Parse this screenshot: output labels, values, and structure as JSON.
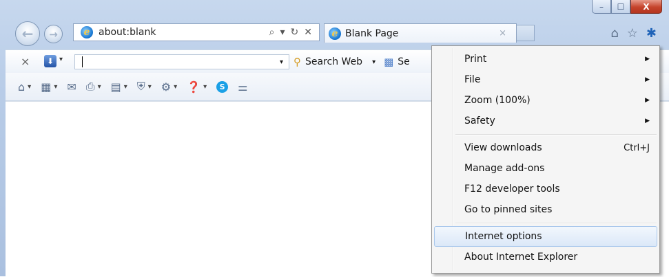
{
  "window_controls": {
    "minimize": "–",
    "maximize": "☐",
    "close": "X"
  },
  "address_bar": {
    "url": "about:blank",
    "search_icon": "⌕",
    "dropdown_icon": "▾",
    "refresh_icon": "↻",
    "stop_icon": "✕"
  },
  "tab": {
    "title": "Blank Page",
    "close": "×"
  },
  "right_icons": {
    "home": "⌂",
    "favorites": "☆",
    "tools": "✱"
  },
  "toolbar": {
    "close": "×",
    "download_icon": "⬇",
    "search_label": "Search Web",
    "truncated_label": "Se"
  },
  "menu": {
    "items": [
      {
        "label": "Print",
        "submenu": true
      },
      {
        "label": "File",
        "submenu": true
      },
      {
        "label": "Zoom (100%)",
        "submenu": true
      },
      {
        "label": "Safety",
        "submenu": true
      },
      {
        "label": "View downloads",
        "shortcut": "Ctrl+J"
      },
      {
        "label": "Manage add-ons"
      },
      {
        "label": "F12 developer tools"
      },
      {
        "label": "Go to pinned sites"
      },
      {
        "label": "Internet options",
        "highlighted": true
      },
      {
        "label": "About Internet Explorer"
      }
    ],
    "submenu_arrow": "▶"
  },
  "colors": {
    "menu_highlight": "#dbe8f8",
    "frame": "#b9cde8"
  }
}
